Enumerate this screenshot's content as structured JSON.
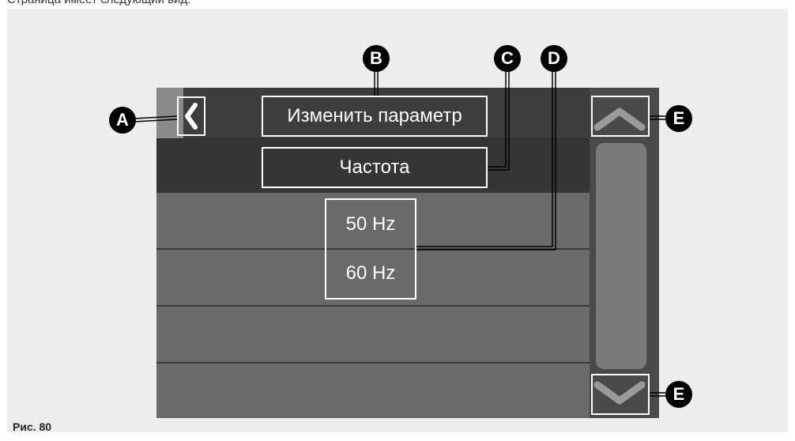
{
  "intro_text": "Страница имеет следующий вид.",
  "figure_caption": "Рис. 80",
  "screen": {
    "header_title": "Изменить параметр",
    "parameter_name": "Частота",
    "options": [
      "50 Hz",
      "60 Hz"
    ],
    "back_symbol": "❮"
  },
  "markers": {
    "a": "A",
    "b": "B",
    "c": "C",
    "d": "D",
    "e1": "E",
    "e2": "E"
  },
  "colors": {
    "panel_bg": "#ededed",
    "screen_bg": "#444444",
    "row_bg": "#6a6a6a",
    "outline": "#ffffff",
    "marker_bg": "#000000"
  },
  "icons": [
    "back-chevron-icon",
    "scroll-up-icon",
    "scroll-down-icon"
  ]
}
